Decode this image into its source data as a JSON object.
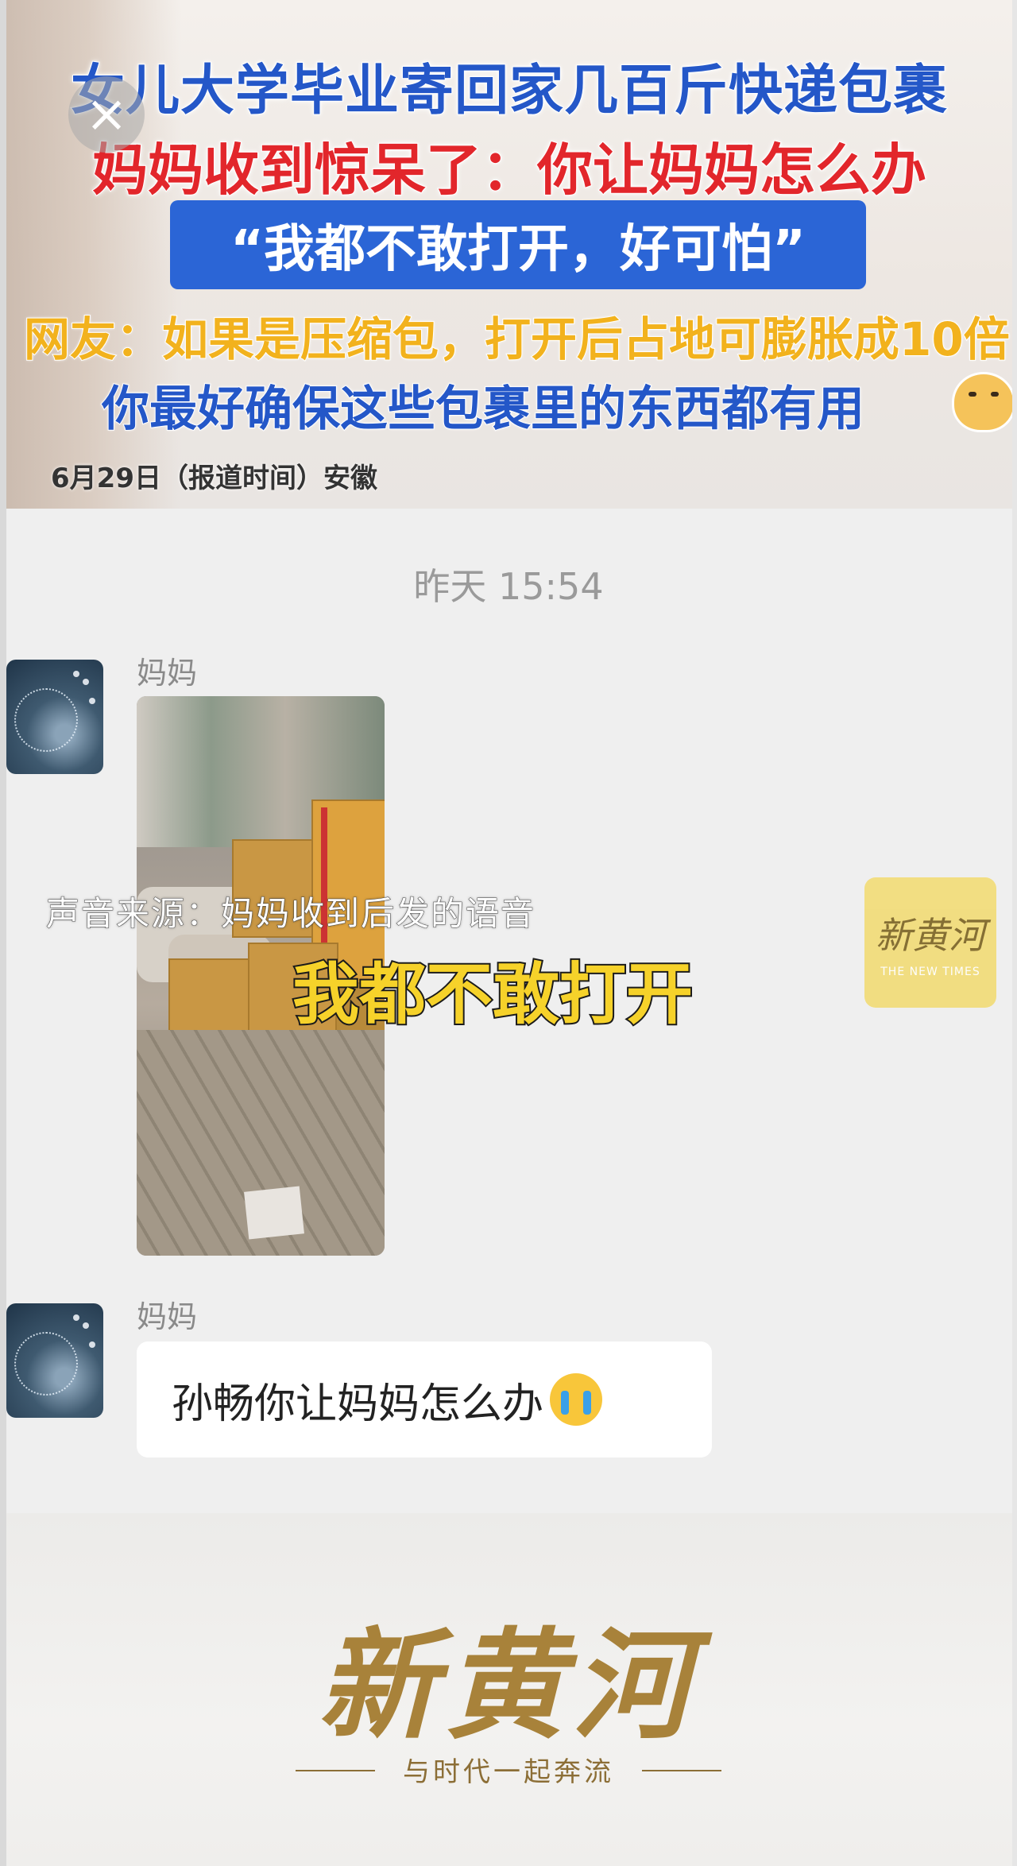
{
  "banner": {
    "headline_line1": "女儿大学毕业寄回家几百斤快递包裹",
    "headline_line2": "妈妈收到惊呆了：你让妈妈怎么办",
    "quote": "“我都不敢打开，好可怕”",
    "netizen_line": "网友：如果是压缩包，打开后占地可膨胀成10倍",
    "advice_line": "你最好确保这些包裹里的东西都有用",
    "dateline": "6月29日（报道时间）安徽",
    "close_icon": "×"
  },
  "chat": {
    "timestamp": "昨天 15:54",
    "messages": [
      {
        "sender": "妈妈",
        "type": "image",
        "overlay_source": "声音来源：妈妈收到后发的语音",
        "overlay_caption": "我都不敢打开"
      },
      {
        "sender": "妈妈",
        "type": "text",
        "text": "孙畅你让妈妈怎么办",
        "emoji": "loudly-crying-face"
      }
    ]
  },
  "watermark": {
    "main": "新黄河",
    "sub": "THE NEW TIMES"
  },
  "footer": {
    "brand": "新黄河",
    "tagline": "与时代一起奔流"
  },
  "colors": {
    "headline_blue": "#2457c8",
    "headline_red": "#e2262b",
    "quote_bg": "#2b65d6",
    "netizen_yellow": "#f2b21d",
    "caption_yellow": "#f6d22a",
    "brand_gold": "#a8823a"
  }
}
